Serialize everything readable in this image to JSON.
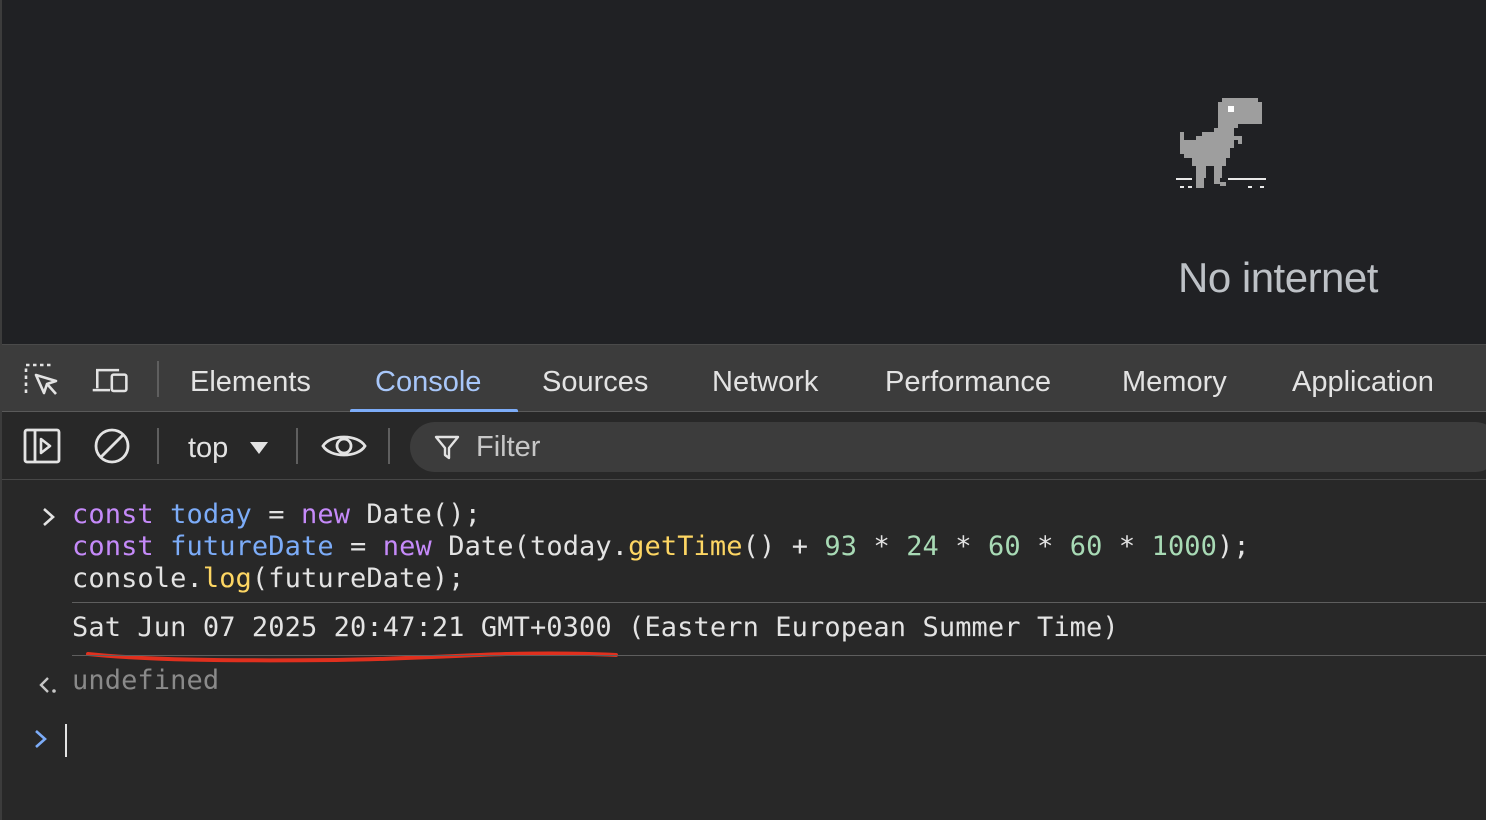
{
  "viewport": {
    "message": "No internet",
    "illustration": "dino-icon"
  },
  "devtools": {
    "toolbar_icons": [
      "inspect-element-icon",
      "device-toolbar-icon"
    ],
    "tabs": [
      {
        "label": "Elements",
        "active": false
      },
      {
        "label": "Console",
        "active": true
      },
      {
        "label": "Sources",
        "active": false
      },
      {
        "label": "Network",
        "active": false
      },
      {
        "label": "Performance",
        "active": false
      },
      {
        "label": "Memory",
        "active": false
      },
      {
        "label": "Application",
        "active": false
      }
    ],
    "console_toolbar": {
      "sidebar_icon": "sidebar-toggle-icon",
      "clear_icon": "clear-console-icon",
      "context": "top",
      "live_expression_icon": "eye-icon",
      "filter_placeholder": "Filter"
    }
  },
  "console": {
    "input": {
      "line1": {
        "t1": "const",
        "t2": " ",
        "t3": "today",
        "t4": " = ",
        "t5": "new",
        "t6": " Date();"
      },
      "line2": {
        "t1": "const",
        "t2": " ",
        "t3": "futureDate",
        "t4": " = ",
        "t5": "new",
        "t6": " Date(today.",
        "t7": "getTime",
        "t8": "() + ",
        "t9": "93",
        "t10": " * ",
        "t11": "24",
        "t12": " * ",
        "t13": "60",
        "t14": " * ",
        "t15": "60",
        "t16": " * ",
        "t17": "1000",
        "t18": ");"
      },
      "line3": {
        "t1": "console.",
        "t2": "log",
        "t3": "(futureDate);"
      }
    },
    "log_output": "Sat Jun 07 2025 20:47:21 GMT+0300 (Eastern European Summer Time)",
    "return_value": "undefined",
    "annotation_color": "#e0301e"
  },
  "colors": {
    "keyword": "#c58af9",
    "variable": "#7cacf8",
    "function": "#fdd663",
    "number": "#a8dab5",
    "active_tab": "#a8c7fa"
  }
}
